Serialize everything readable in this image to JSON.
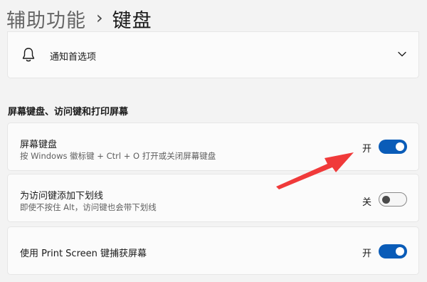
{
  "breadcrumb": {
    "parent": "辅助功能",
    "separator": "›",
    "current": "键盘"
  },
  "notifications": {
    "label": "通知首选项",
    "icon": "bell-icon",
    "expand_icon": "chevron-down-icon"
  },
  "section": {
    "heading": "屏幕键盘、访问键和打印屏幕"
  },
  "settings": [
    {
      "title": "屏幕键盘",
      "description": "按 Windows 徽标键 + Ctrl + O 打开或关闭屏幕键盘",
      "state_label": "开",
      "on": true
    },
    {
      "title": "为访问键添加下划线",
      "description": "即使不按住 Alt，访问键也会带下划线",
      "state_label": "关",
      "on": false
    },
    {
      "title": "使用 Print Screen 键捕获屏幕",
      "state_label": "开",
      "on": true
    }
  ],
  "colors": {
    "accent": "#0a5cb8",
    "annotation_arrow": "#f03a3a"
  }
}
